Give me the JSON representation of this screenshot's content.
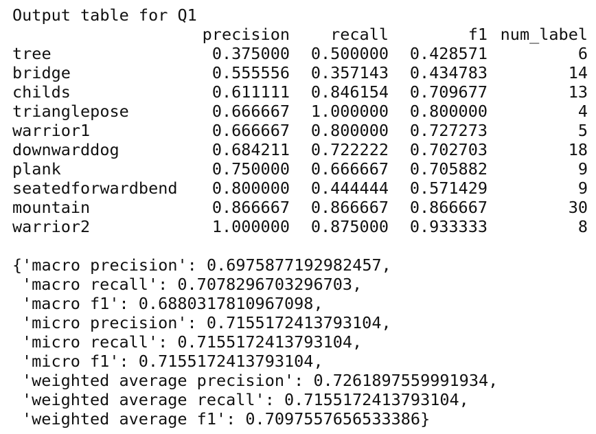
{
  "output": {
    "title": "Output table for Q1",
    "columns": [
      "precision",
      "recall",
      "f1",
      "num_label"
    ],
    "rows": [
      {
        "label": "tree",
        "precision": "0.375000",
        "recall": "0.500000",
        "f1": "0.428571",
        "num_label": "6"
      },
      {
        "label": "bridge",
        "precision": "0.555556",
        "recall": "0.357143",
        "f1": "0.434783",
        "num_label": "14"
      },
      {
        "label": "childs",
        "precision": "0.611111",
        "recall": "0.846154",
        "f1": "0.709677",
        "num_label": "13"
      },
      {
        "label": "trianglepose",
        "precision": "0.666667",
        "recall": "1.000000",
        "f1": "0.800000",
        "num_label": "4"
      },
      {
        "label": "warrior1",
        "precision": "0.666667",
        "recall": "0.800000",
        "f1": "0.727273",
        "num_label": "5"
      },
      {
        "label": "downwarddog",
        "precision": "0.684211",
        "recall": "0.722222",
        "f1": "0.702703",
        "num_label": "18"
      },
      {
        "label": "plank",
        "precision": "0.750000",
        "recall": "0.666667",
        "f1": "0.705882",
        "num_label": "9"
      },
      {
        "label": "seatedforwardbend",
        "precision": "0.800000",
        "recall": "0.444444",
        "f1": "0.571429",
        "num_label": "9"
      },
      {
        "label": "mountain",
        "precision": "0.866667",
        "recall": "0.866667",
        "f1": "0.866667",
        "num_label": "30"
      },
      {
        "label": "warrior2",
        "precision": "1.000000",
        "recall": "0.875000",
        "f1": "0.933333",
        "num_label": "8"
      }
    ],
    "metrics_lines": [
      "{'macro precision': 0.6975877192982457,",
      "'macro recall': 0.7078296703296703,",
      "'macro f1': 0.6880317810967098,",
      "'micro precision': 0.7155172413793104,",
      "'micro recall': 0.7155172413793104,",
      "'micro f1': 0.7155172413793104,",
      "'weighted average precision': 0.7261897559991934,",
      "'weighted average recall': 0.7155172413793104,",
      "'weighted average f1': 0.7097557656533386}"
    ]
  }
}
